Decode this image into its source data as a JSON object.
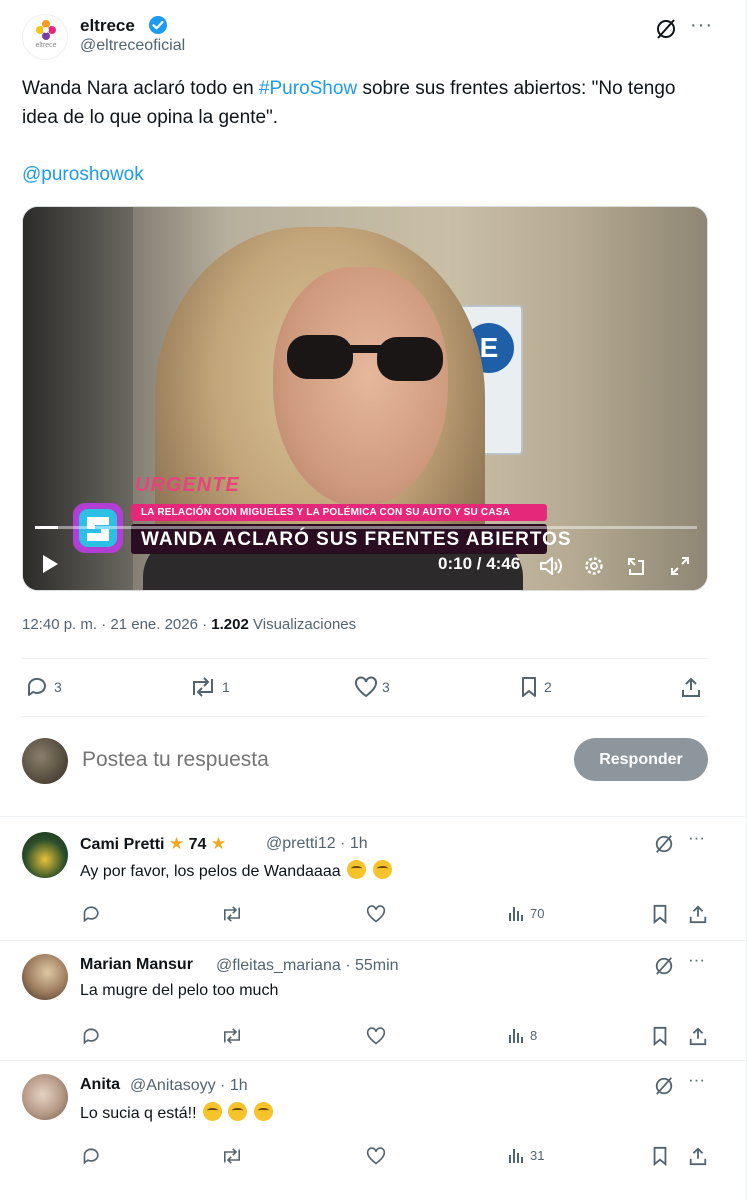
{
  "tweet": {
    "author_name": "eltrece",
    "author_handle": "@eltreceoficial",
    "logo_text": "eltrece",
    "text_before": "Wanda Nara aclaró todo en ",
    "hashtag": "#PuroShow",
    "text_after": " sobre sus frentes abiertos: \"No tengo idea de lo que opina la gente\".",
    "mention": "@puroshowok",
    "more": "···"
  },
  "video": {
    "lower_tag": "URGENTE",
    "subtitle": "LA RELACIÓN CON MIGUELES Y LA POLÉMICA CON SU AUTO Y SU CASA",
    "headline": "WANDA ACLARÓ SUS FRENTES ABIERTOS",
    "sign_letter": "E",
    "time": "0:10 / 4:46",
    "progress": 0.035
  },
  "meta": {
    "timestamp": "12:40 p. m. · 21 ene. 2026 · ",
    "views": "1.202",
    "views_label": " Visualizaciones"
  },
  "actions": {
    "replies": "3",
    "reposts": "1",
    "likes": "3",
    "bookmarks": "2"
  },
  "composer": {
    "placeholder": "Postea tu respuesta",
    "button": "Responder"
  },
  "replies": [
    {
      "name": "Cami Pretti",
      "badge": "74",
      "handle_time": "@pretti12 · 1h",
      "text": "Ay por favor, los pelos de Wandaaaa",
      "views": "70",
      "avatar_color": "#2c4f2a"
    },
    {
      "name": "Marian Mansur",
      "handle_time": "@fleitas_mariana · 55min",
      "text": "La mugre del pelo too much",
      "views": "8",
      "avatar_color": "#9b7a5c"
    },
    {
      "name": "Anita",
      "handle_time": "@Anitasoyy · 1h",
      "text": "Lo sucia q está!!",
      "views": "31",
      "avatar_color": "#b59a86"
    }
  ],
  "colors": {
    "link": "#1d9bf0",
    "text_secondary": "#536471",
    "accent_pink": "#e6287a"
  }
}
